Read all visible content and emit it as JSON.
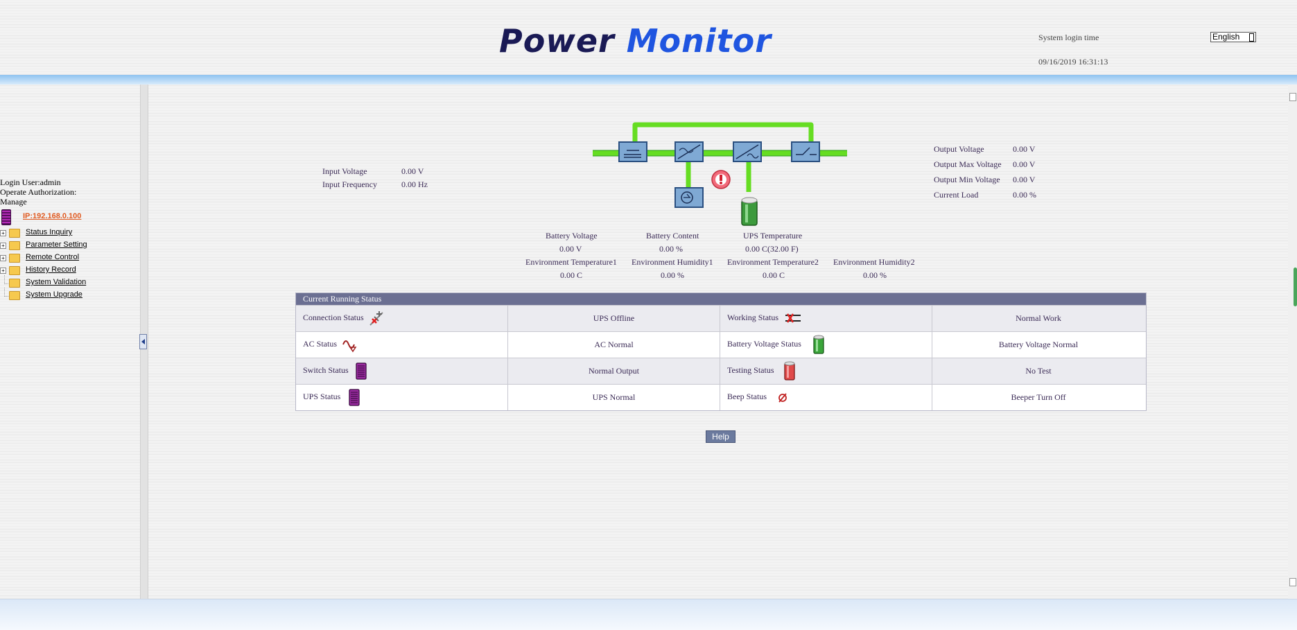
{
  "header": {
    "logo_word1": "Power",
    "logo_word2": "Monitor",
    "login_time_label": "System login time",
    "login_time_value": "09/16/2019 16:31:13",
    "language": "English"
  },
  "sidebar": {
    "user": "Login User:admin",
    "authorization": "Operate Authorization:",
    "authorization_value": "Manage",
    "ip": "IP:192.168.0.100",
    "items": [
      {
        "label": "Status Inquiry",
        "expandable": true
      },
      {
        "label": "Parameter Setting",
        "expandable": true
      },
      {
        "label": "Remote Control",
        "expandable": true
      },
      {
        "label": "History Record",
        "expandable": true
      },
      {
        "label": "System Validation",
        "expandable": false
      },
      {
        "label": "System Upgrade",
        "expandable": false
      }
    ]
  },
  "input": {
    "voltage_label": "Input Voltage",
    "voltage_value": "0.00 V",
    "frequency_label": "Input Frequency",
    "frequency_value": "0.00 Hz"
  },
  "output": {
    "voltage_label": "Output Voltage",
    "voltage_value": "0.00 V",
    "max_voltage_label": "Output Max Voltage",
    "max_voltage_value": "0.00 V",
    "min_voltage_label": "Output Min Voltage",
    "min_voltage_value": "0.00 V",
    "load_label": "Current Load",
    "load_value": "0.00 %"
  },
  "metrics": {
    "battery_voltage_label": "Battery Voltage",
    "battery_voltage_value": "0.00  V",
    "battery_content_label": "Battery Content",
    "battery_content_value": "0.00  %",
    "ups_temp_label": "UPS Temperature",
    "ups_temp_value": "0.00  C(32.00 F)",
    "env_temp1_label": "Environment Temperature1",
    "env_temp1_value": "0.00 C",
    "env_hum1_label": "Environment Humidity1",
    "env_hum1_value": "0.00 %",
    "env_temp2_label": "Environment Temperature2",
    "env_temp2_value": "0.00 C",
    "env_hum2_label": "Environment Humidity2",
    "env_hum2_value": "0.00 %"
  },
  "status": {
    "title": "Current Running Status",
    "rows": [
      {
        "l1": "Connection Status",
        "v1": "UPS Offline",
        "l2": "Working Status",
        "v2": "Normal Work",
        "icon1": "disconnected-plug-icon",
        "icon2": "working-status-icon"
      },
      {
        "l1": "AC Status",
        "v1": "AC Normal",
        "l2": "Battery Voltage Status",
        "v2": "Battery Voltage Normal",
        "icon1": "ac-wave-icon",
        "icon2": "green-battery-icon"
      },
      {
        "l1": "Switch Status",
        "v1": "Normal Output",
        "l2": "Testing Status",
        "v2": "No Test",
        "icon1": "ups-unit-icon",
        "icon2": "red-battery-icon"
      },
      {
        "l1": "UPS Status",
        "v1": "UPS Normal",
        "l2": "Beep Status",
        "v2": "Beeper Turn Off",
        "icon1": "ups-unit-icon",
        "icon2": "beeper-off-icon"
      }
    ]
  },
  "help_label": "Help",
  "colors": {
    "accent": "#6b6f92",
    "flow_green": "#66dd22",
    "logo_blue": "#1f55e0"
  }
}
